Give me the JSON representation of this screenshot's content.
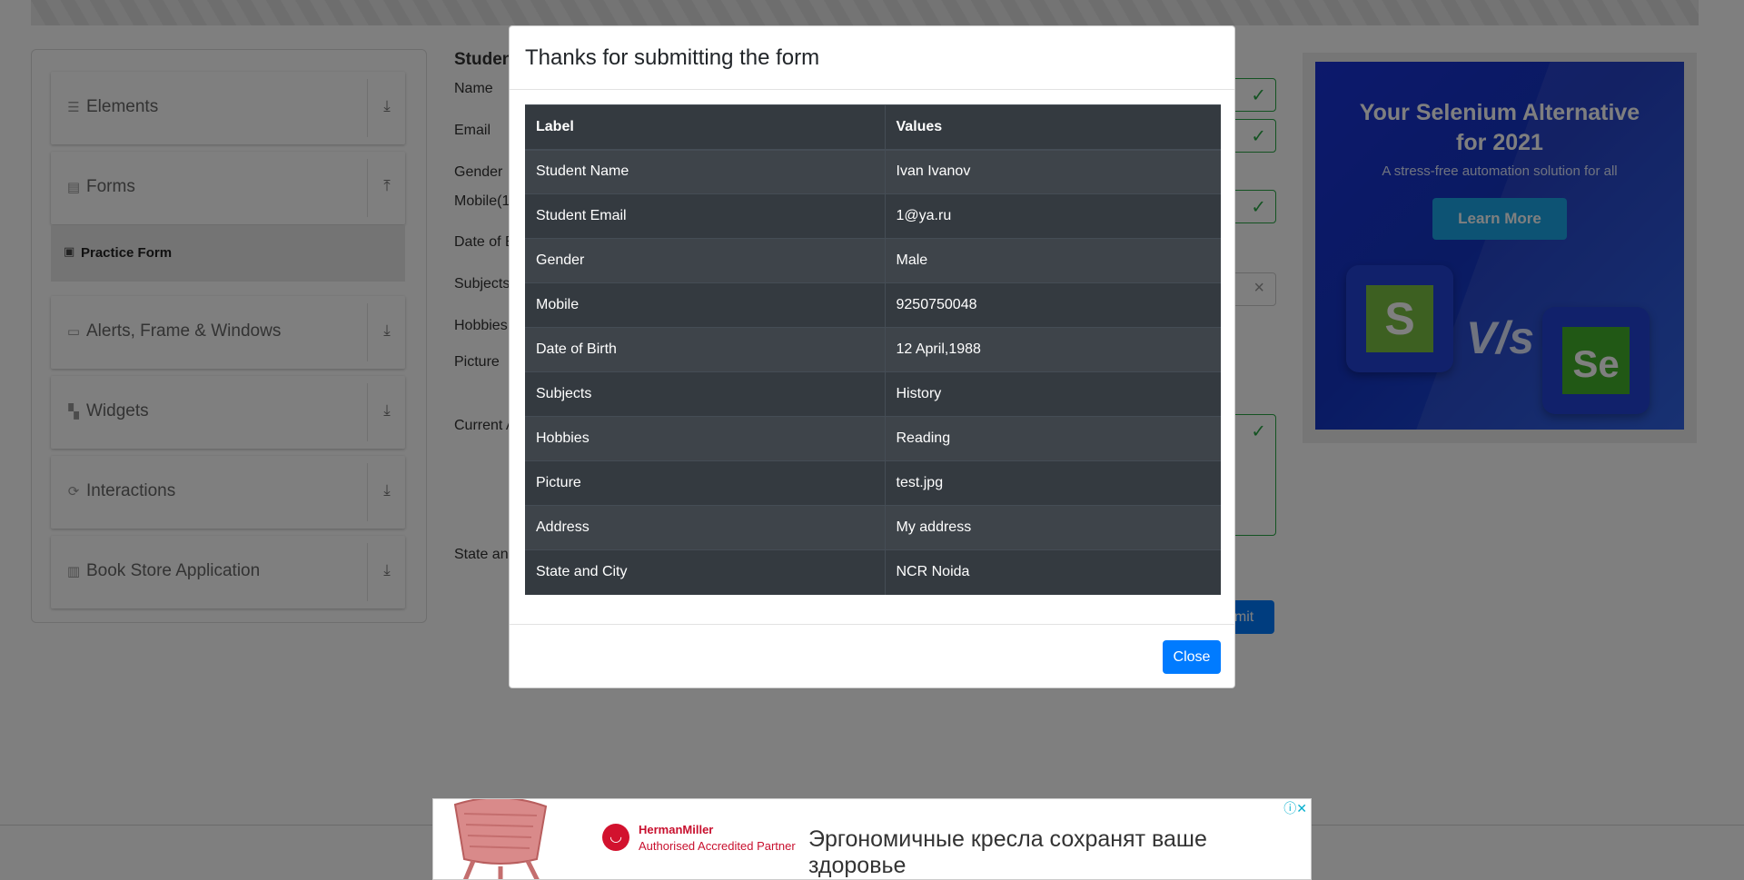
{
  "sidebar": {
    "groups": [
      {
        "label": "Elements",
        "icon": "list-icon"
      },
      {
        "label": "Forms",
        "icon": "document-icon"
      },
      {
        "label": "Alerts, Frame & Windows",
        "icon": "window-icon"
      },
      {
        "label": "Widgets",
        "icon": "widgets-icon"
      },
      {
        "label": "Interactions",
        "icon": "interactions-icon"
      },
      {
        "label": "Book Store Application",
        "icon": "books-icon"
      }
    ],
    "active_item": "Practice Form"
  },
  "form": {
    "title": "Studen",
    "labels": {
      "name": "Name",
      "email": "Email",
      "gender": "Gender",
      "mobile": "Mobile(1",
      "dob": "Date of B",
      "subjects": "Subjects",
      "hobbies": "Hobbies",
      "picture": "Picture",
      "address": "Current A",
      "state": "State and"
    },
    "submit_label": "bmit"
  },
  "modal": {
    "title": "Thanks for submitting the form",
    "headers": [
      "Label",
      "Values"
    ],
    "rows": [
      [
        "Student Name",
        "Ivan Ivanov"
      ],
      [
        "Student Email",
        "1@ya.ru"
      ],
      [
        "Gender",
        "Male"
      ],
      [
        "Mobile",
        "9250750048"
      ],
      [
        "Date of Birth",
        "12 April,1988"
      ],
      [
        "Subjects",
        "History"
      ],
      [
        "Hobbies",
        "Reading"
      ],
      [
        "Picture",
        "test.jpg"
      ],
      [
        "Address",
        "My address"
      ],
      [
        "State and City",
        "NCR Noida"
      ]
    ],
    "close_label": "Close"
  },
  "ad_right": {
    "headline_1": "Your Selenium Alternative",
    "headline_2": "for 2021",
    "subtitle": "A stress-free automation solution for all",
    "button": "Learn More",
    "logo_left": "S",
    "versus": "V/s",
    "logo_right": "Se"
  },
  "ad_bottom": {
    "brand": "HermanMiller",
    "tagline": "Authorised Accredited Partner",
    "slogan": "Эргономичные кресла сохранят ваше здоровье"
  }
}
